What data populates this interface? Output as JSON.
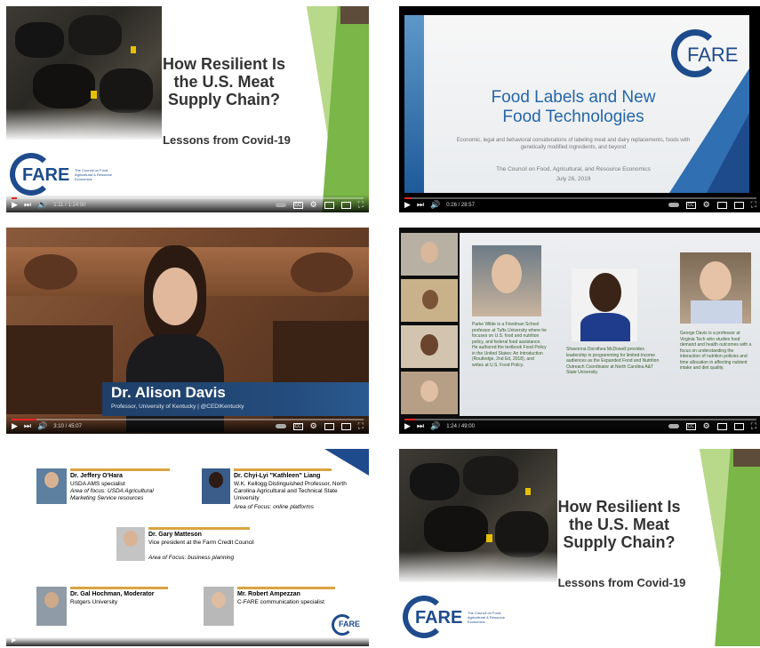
{
  "video1": {
    "title": "How Resilient Is the U.S. Meat Supply Chain?",
    "subtitle": "Lessons from Covid-19",
    "logo_text": "FARE",
    "logo_tag": "The Council on Food, Agricultural & Resource Economics",
    "time": "1:11 / 1:24:50",
    "progress": 0.015
  },
  "video2": {
    "title_line1": "Food Labels and New",
    "title_line2": "Food Technologies",
    "desc": "Economic, legal and behavioral considerations of labeling meat and dairy replacements, foods with genetically modified ingredients, and beyond",
    "org": "The Council on Food, Agricultural, and Resource Economics",
    "date": "July 26, 2019",
    "logo_text": "FARE",
    "time": "0:26 / 28:57",
    "progress": 0.02
  },
  "video3": {
    "name": "Dr. Alison Davis",
    "role": "Professor, University of Kentucky | @CEDIKentucky",
    "time": "3:10 / 45:07",
    "progress": 0.07
  },
  "video4": {
    "bio1": "Parke Wilde is a Friedman School professor at Tufts University where he focuses on U.S. food and nutrition policy, and federal food assistance. He authored the textbook Food Policy in the United States: An Introduction (Routledge, 2nd Ed, 2018), and writes at U.S. Food Policy.",
    "bio2": "Shavonna Dorothea McDowell provides leadership in programming for limited-income audiences as the Expanded Food and Nutrition Outreach Coordinator at North Carolina A&T State University.",
    "bio3": "George Davis is a professor at Virginia Tech who studies food demand and health outcomes with a focus on understanding the interaction of nutrition policies and time allocation in affecting nutrient intake and diet quality.",
    "time": "1:24 / 49:00",
    "progress": 0.03
  },
  "video5": {
    "p1_name": "Dr. Jeffery O'Hara",
    "p1_line1": "USDA AMS specialist",
    "p1_line2": "Area of focus: USDA Agricultural Marketing Service resources",
    "p2_name": "Dr. Chyi-Lyi \"Kathleen\" Liang",
    "p2_line1": "W.K. Kellogg Distinguished Professor, North Carolina Agricultural and Technical State University",
    "p2_line2": "Area of Focus: online platforms",
    "p3_name": "Dr. Gary Matteson",
    "p3_line1": "Vice president at the Farm Credit Council",
    "p3_line2": "Area of Focus: business planning",
    "p4_name": "Dr. Gal Hochman, Moderator",
    "p4_line1": "Rutgers University",
    "p5_name": "Mr. Robert Ampezzan",
    "p5_line1": "C-FARE communication specialist",
    "logo_text": "FARE"
  },
  "video6": {
    "title": "How Resilient Is the U.S. Meat Supply Chain?",
    "subtitle": "Lessons from Covid-19",
    "logo_text": "FARE",
    "logo_tag": "The Council on Food, Agricultural & Resource Economics"
  },
  "colors": {
    "fare_blue": "#1e4b8c",
    "slide_green": "#7ab648",
    "slide_blue": "#2f6fb2",
    "gold": "#d9a441",
    "progress_red": "#e22222"
  },
  "controls": {
    "play_icon": "▶",
    "next_icon": "⏭",
    "volume_icon": "🔊",
    "settings_icon": "⚙",
    "fullscreen_icon": "⛶",
    "cc_label": "CC"
  }
}
